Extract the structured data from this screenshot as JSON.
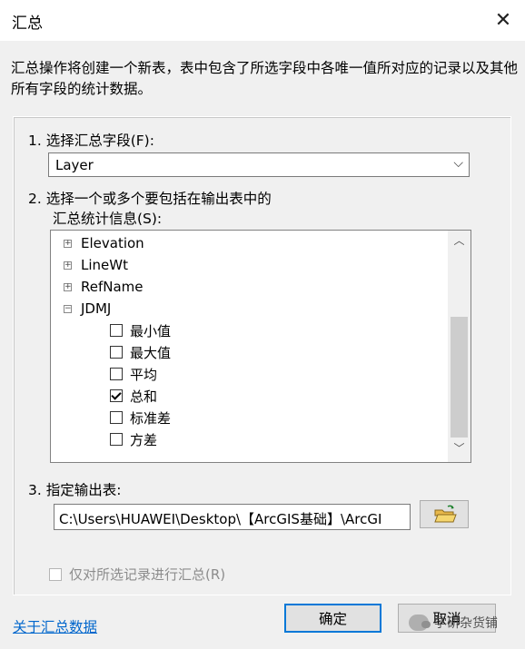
{
  "window": {
    "title": "汇总"
  },
  "description": "汇总操作将创建一个新表，表中包含了所选字段中各唯一值所对应的记录以及其他所有字段的统计数据。",
  "step1": {
    "label": "1. 选择汇总字段(F):",
    "selected": "Layer"
  },
  "step2": {
    "label_line1": "2. 选择一个或多个要包括在输出表中的",
    "label_line2": "汇总统计信息(S):",
    "tree": {
      "groups": [
        {
          "label": "Elevation",
          "expander": "+"
        },
        {
          "label": "LineWt",
          "expander": "+"
        },
        {
          "label": "RefName",
          "expander": "+"
        },
        {
          "label": "JDMJ",
          "expander": "−"
        }
      ],
      "stats": [
        {
          "label": "最小值",
          "checked": false
        },
        {
          "label": "最大值",
          "checked": false
        },
        {
          "label": "平均",
          "checked": false
        },
        {
          "label": "总和",
          "checked": true
        },
        {
          "label": "标准差",
          "checked": false
        },
        {
          "label": "方差",
          "checked": false
        }
      ]
    }
  },
  "step3": {
    "label": "3. 指定输出表:",
    "path": "C:\\Users\\HUAWEI\\Desktop\\【ArcGIS基础】\\ArcGI"
  },
  "selected_only": {
    "label": "仅对所选记录进行汇总(R)",
    "checked": false,
    "enabled": false
  },
  "footer": {
    "help_link": "关于汇总数据",
    "ok": "确定",
    "cancel": "取消",
    "watermark": "学研杂货铺"
  },
  "colors": {
    "accent": "#0078d7",
    "link": "#0066cc",
    "background": "#f0f0f0"
  }
}
